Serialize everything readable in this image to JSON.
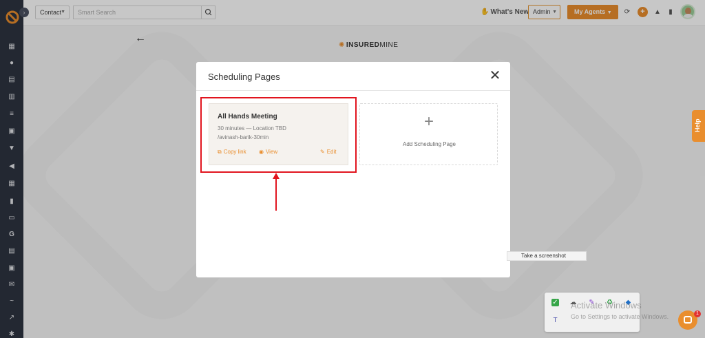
{
  "colors": {
    "accent": "#e98e2e",
    "sidebar": "#2e3440",
    "highlight": "#e1141e"
  },
  "topbar": {
    "contact_select": "Contact",
    "search_placeholder": "Smart Search",
    "whats_new": "What's New",
    "admin_select": "Admin",
    "agents_button": "My Agents"
  },
  "sidebar": {
    "icons": [
      "dashboard-icon",
      "contacts-icon",
      "documents-icon",
      "bank-icon",
      "list-icon",
      "contact-card-icon",
      "filter-icon",
      "megaphone-icon",
      "calendar-grid-icon",
      "bar-chart-icon",
      "folder-icon",
      "google-icon",
      "spreadsheet-icon",
      "calendar-icon",
      "mail-icon",
      "signature-icon",
      "line-chart-icon",
      "settings-icon"
    ]
  },
  "background": {
    "brand_bold": "INSURED",
    "brand_light": "MINE"
  },
  "help_tab": "Help",
  "modal": {
    "title": "Scheduling Pages",
    "card": {
      "title": "All Hands Meeting",
      "meta": "30 minutes — Location TBD",
      "slug": "/avinash-barik-30min",
      "copy_link": "Copy link",
      "view": "View",
      "edit": "Edit"
    },
    "add_label": "Add Scheduling Page"
  },
  "tooltip": "Take a screenshot",
  "windows_watermark": {
    "title": "Activate Windows",
    "subtitle": "Go to Settings to activate Windows."
  },
  "chat_badge": "1"
}
